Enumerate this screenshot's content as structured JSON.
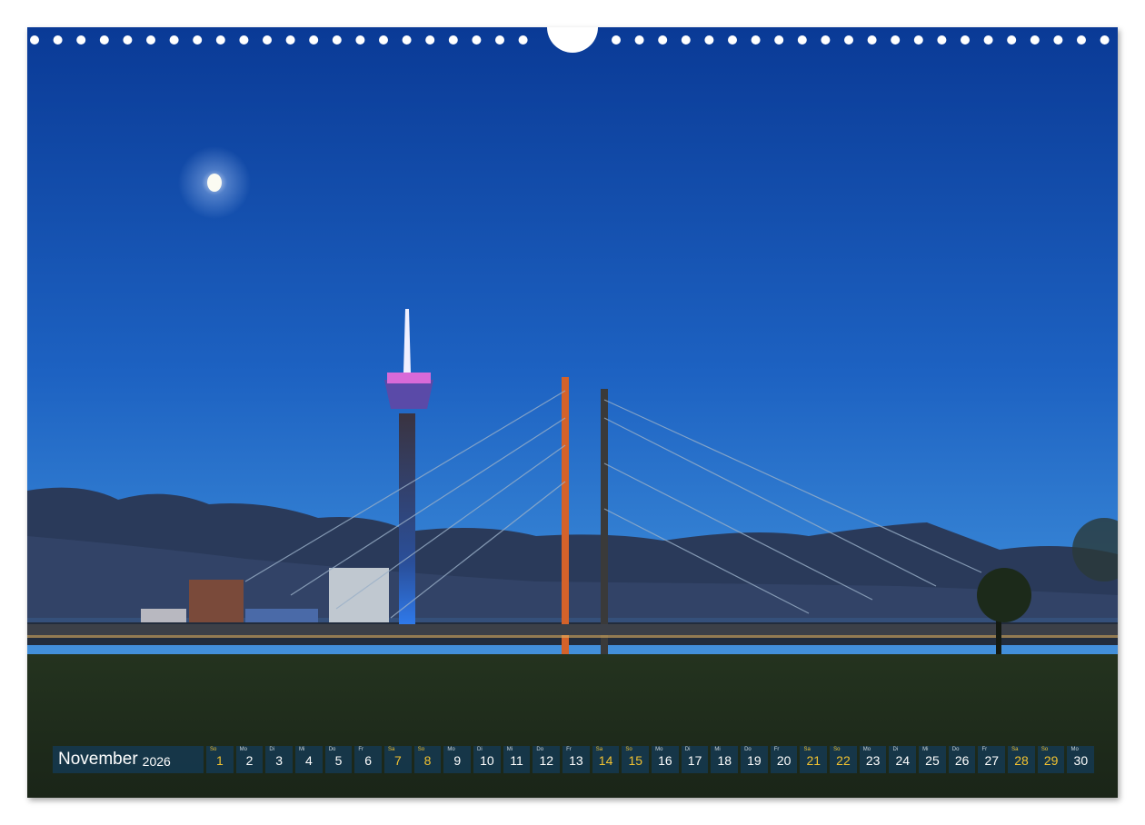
{
  "calendar": {
    "month": "November",
    "year": "2026",
    "days": [
      {
        "dow": "So",
        "num": "1",
        "weekend": true
      },
      {
        "dow": "Mo",
        "num": "2",
        "weekend": false
      },
      {
        "dow": "Di",
        "num": "3",
        "weekend": false
      },
      {
        "dow": "Mi",
        "num": "4",
        "weekend": false
      },
      {
        "dow": "Do",
        "num": "5",
        "weekend": false
      },
      {
        "dow": "Fr",
        "num": "6",
        "weekend": false
      },
      {
        "dow": "Sa",
        "num": "7",
        "weekend": true
      },
      {
        "dow": "So",
        "num": "8",
        "weekend": true
      },
      {
        "dow": "Mo",
        "num": "9",
        "weekend": false
      },
      {
        "dow": "Di",
        "num": "10",
        "weekend": false
      },
      {
        "dow": "Mi",
        "num": "11",
        "weekend": false
      },
      {
        "dow": "Do",
        "num": "12",
        "weekend": false
      },
      {
        "dow": "Fr",
        "num": "13",
        "weekend": false
      },
      {
        "dow": "Sa",
        "num": "14",
        "weekend": true
      },
      {
        "dow": "So",
        "num": "15",
        "weekend": true
      },
      {
        "dow": "Mo",
        "num": "16",
        "weekend": false
      },
      {
        "dow": "Di",
        "num": "17",
        "weekend": false
      },
      {
        "dow": "Mi",
        "num": "18",
        "weekend": false
      },
      {
        "dow": "Do",
        "num": "19",
        "weekend": false
      },
      {
        "dow": "Fr",
        "num": "20",
        "weekend": false
      },
      {
        "dow": "Sa",
        "num": "21",
        "weekend": true
      },
      {
        "dow": "So",
        "num": "22",
        "weekend": true
      },
      {
        "dow": "Mo",
        "num": "23",
        "weekend": false
      },
      {
        "dow": "Di",
        "num": "24",
        "weekend": false
      },
      {
        "dow": "Mi",
        "num": "25",
        "weekend": false
      },
      {
        "dow": "Do",
        "num": "26",
        "weekend": false
      },
      {
        "dow": "Fr",
        "num": "27",
        "weekend": false
      },
      {
        "dow": "Sa",
        "num": "28",
        "weekend": true
      },
      {
        "dow": "So",
        "num": "29",
        "weekend": true
      },
      {
        "dow": "Mo",
        "num": "30",
        "weekend": false
      }
    ]
  },
  "colors": {
    "sky_top": "#0b3f9c",
    "sky_bottom": "#3a8ad8",
    "weekend_text": "#f2c230",
    "strip_bg": "#143c5a"
  }
}
